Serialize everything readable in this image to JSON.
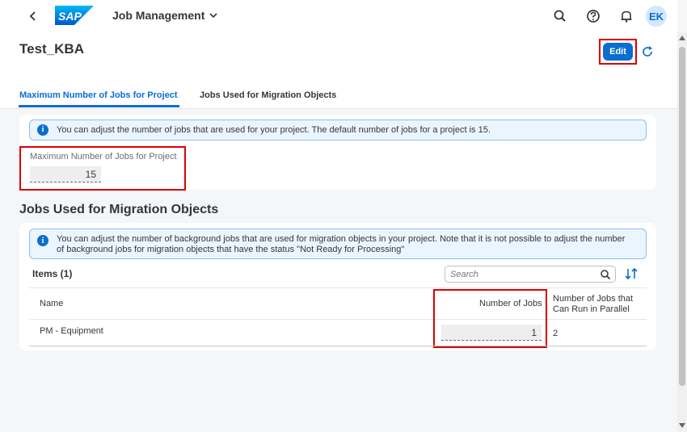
{
  "shell": {
    "app_title": "Job Management",
    "user_initials": "EK"
  },
  "page": {
    "title": "Test_KBA",
    "edit_label": "Edit"
  },
  "tabs": [
    {
      "label": "Maximum Number of Jobs for Project",
      "active": true
    },
    {
      "label": "Jobs Used for Migration Objects",
      "active": false
    }
  ],
  "project_section": {
    "info_message": "You can adjust the number of jobs that are used for your project. The default number of jobs for a project is 15.",
    "field_label": "Maximum Number of Jobs for Project",
    "field_value": "15"
  },
  "migration_section": {
    "title": "Jobs Used for Migration Objects",
    "info_message_line1": "You can adjust the number of background jobs that are used for migration objects in your project. Note that it is not possible to adjust the number",
    "info_message_line2": "of background jobs for migration objects that have the status \"Not Ready for Processing\"",
    "items_label": "Items (1)",
    "search_placeholder": "Search",
    "columns": {
      "name": "Name",
      "jobs": "Number of Jobs",
      "parallel_line1": "Number of Jobs that",
      "parallel_line2": "Can Run in Parallel"
    },
    "rows": [
      {
        "name": "PM - Equipment",
        "jobs": "1",
        "parallel": "2"
      }
    ]
  },
  "colors": {
    "accent": "#0a6ed1",
    "highlight_border": "#dd0000",
    "info_bg": "#ebf5fe"
  }
}
